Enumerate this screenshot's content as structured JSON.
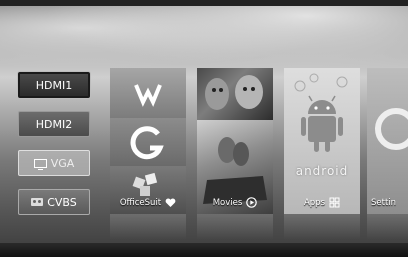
{
  "sources": [
    {
      "label": "HDMI1"
    },
    {
      "label": "HDMI2"
    },
    {
      "label": "VGA"
    },
    {
      "label": "CVBS"
    }
  ],
  "tiles": {
    "office": {
      "label": "OfficeSuit"
    },
    "movies": {
      "label": "Movies"
    },
    "apps": {
      "label": "Apps",
      "logo_text": "android"
    },
    "settings": {
      "label": "Settin"
    }
  },
  "icons": {
    "office_logo": "wps-logo-icon",
    "office_secondary": "g-swirl-logo-icon",
    "heart": "heart-icon",
    "play": "play-circle-icon",
    "apps_grid": "grid-icon",
    "android": "android-robot-icon",
    "settings": "settings-gear-icon"
  },
  "colors": {
    "selected_source_bg": "#2f2f2f",
    "tile_text": "#ffffff"
  }
}
